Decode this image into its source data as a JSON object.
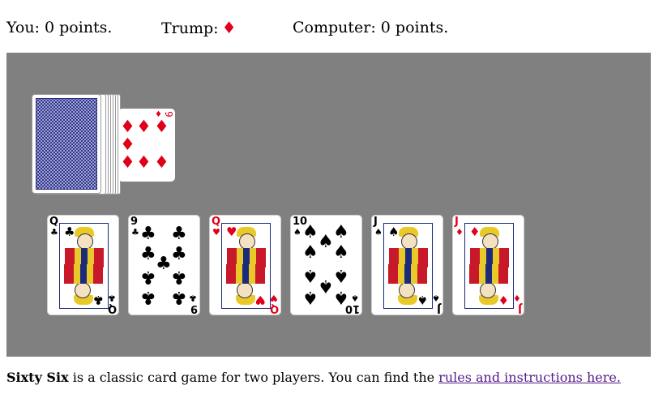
{
  "header": {
    "you_label": "You: 0 points.",
    "trump_label": "Trump:",
    "trump_suit": "♦",
    "computer_label": "Computer: 0 points."
  },
  "table": {
    "background": "#808080",
    "deck": {
      "face_down": true,
      "icon": "card-back-icon"
    },
    "trump_card": {
      "rank": "9",
      "suit": "♦",
      "color": "red"
    },
    "hand": [
      {
        "rank": "Q",
        "suit": "♣",
        "color": "black",
        "face": true
      },
      {
        "rank": "9",
        "suit": "♣",
        "color": "black",
        "face": false
      },
      {
        "rank": "Q",
        "suit": "♥",
        "color": "red",
        "face": true
      },
      {
        "rank": "10",
        "suit": "♠",
        "color": "black",
        "face": false
      },
      {
        "rank": "J",
        "suit": "♠",
        "color": "black",
        "face": true
      },
      {
        "rank": "J",
        "suit": "♦",
        "color": "red",
        "face": true
      }
    ]
  },
  "footer": {
    "title": "Sixty Six",
    "text": " is a classic card game for two players. You can find the ",
    "link_text": "rules and instructions here."
  },
  "colors": {
    "red_suit": "#e0001b",
    "link": "#551a8b"
  }
}
